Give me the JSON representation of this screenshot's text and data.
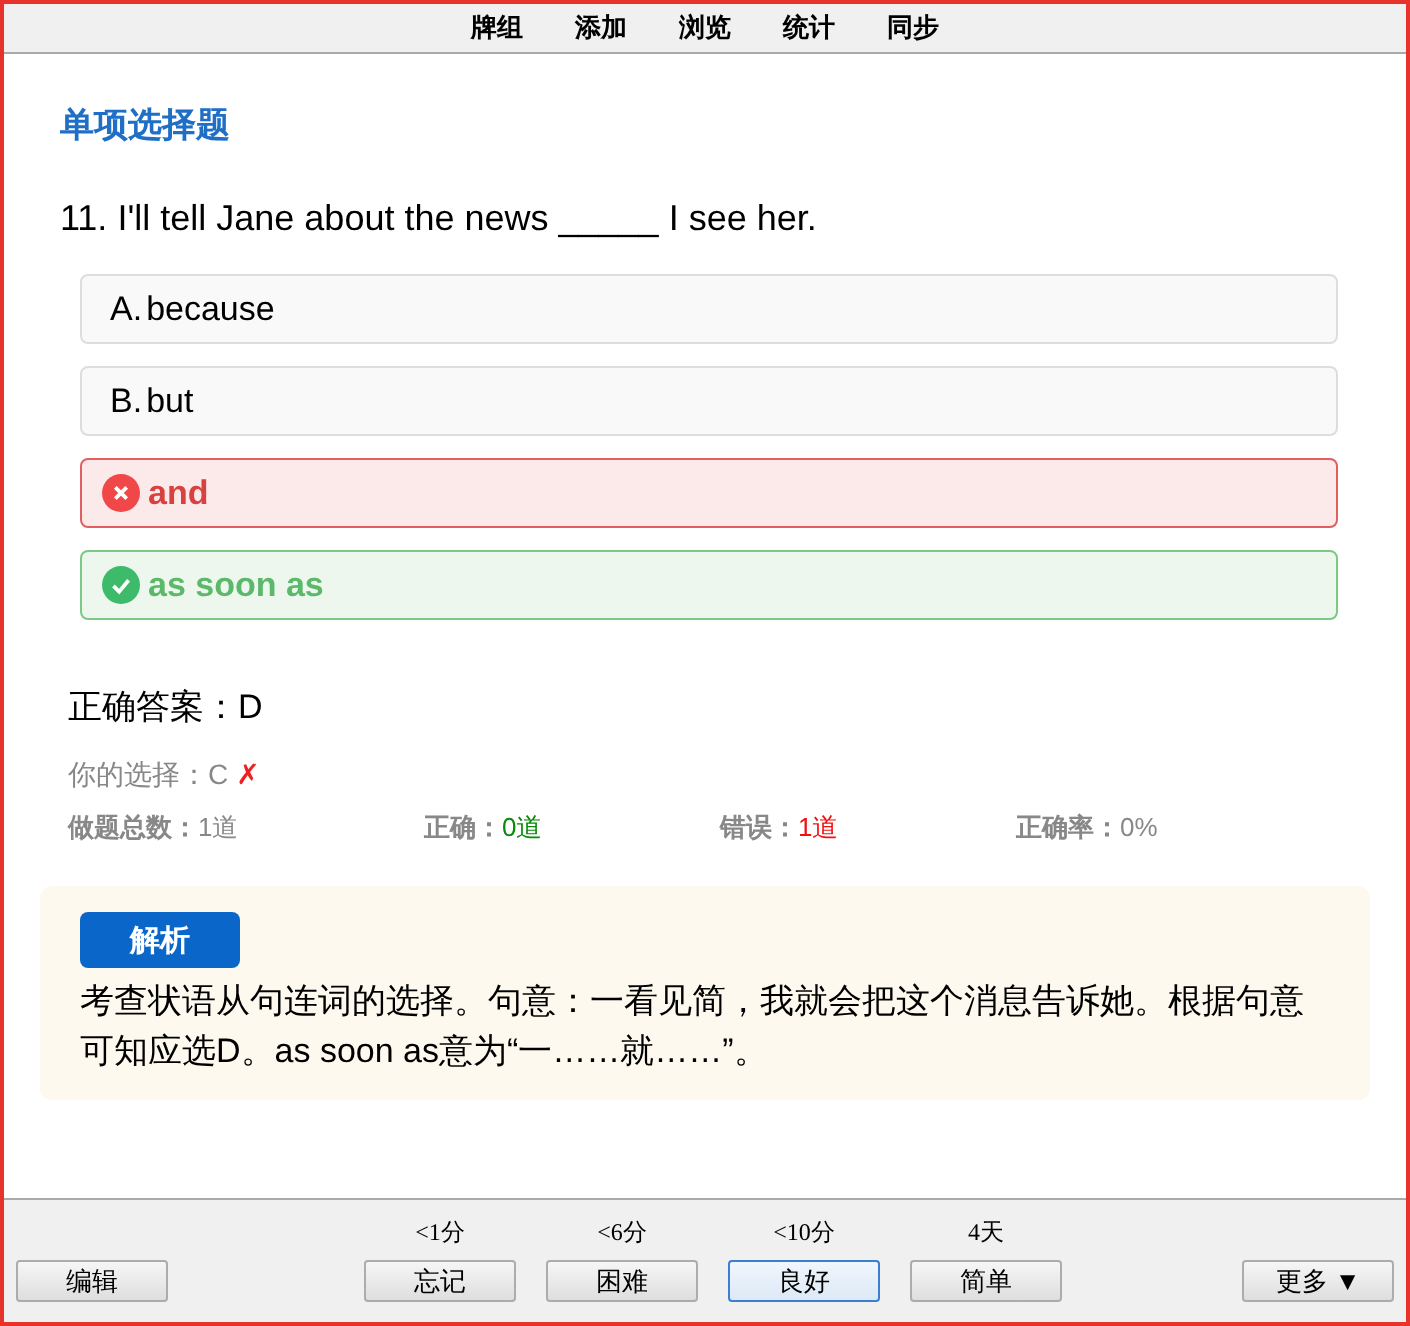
{
  "top_menu": [
    "牌组",
    "添加",
    "浏览",
    "统计",
    "同步"
  ],
  "section_title": "单项选择题",
  "question": "11. I'll tell Jane about the news _____ I see her.",
  "options": [
    {
      "letter": "A.",
      "text": "because",
      "kind": "neutral"
    },
    {
      "letter": "B.",
      "text": "but",
      "kind": "neutral"
    },
    {
      "text": "and",
      "kind": "wrong"
    },
    {
      "text": "as soon as",
      "kind": "correct"
    }
  ],
  "correct_answer": "正确答案：D",
  "your_choice": {
    "label": "你的选择：C",
    "mark": "✗"
  },
  "stats": [
    {
      "label": "做题总数：",
      "value": "1道",
      "kind": "plain"
    },
    {
      "label": "正确：",
      "value": "0道",
      "kind": "good"
    },
    {
      "label": "错误：",
      "value": "1道",
      "kind": "bad"
    },
    {
      "label": "正确率：",
      "value": "0%",
      "kind": "plain"
    }
  ],
  "analysis": {
    "badge": "解析",
    "text": "考查状语从句连词的选择。句意：一看见简，我就会把这个消息告诉她。根据句意可知应选D。as soon as意为“一……就……”。"
  },
  "bottom_bar": {
    "edit": "编辑",
    "more": "更多 ▼",
    "answers": [
      {
        "interval": "<1分",
        "label": "忘记",
        "selected": false
      },
      {
        "interval": "<6分",
        "label": "困难",
        "selected": false
      },
      {
        "interval": "<10分",
        "label": "良好",
        "selected": true
      },
      {
        "interval": "4天",
        "label": "简单",
        "selected": false
      }
    ]
  }
}
